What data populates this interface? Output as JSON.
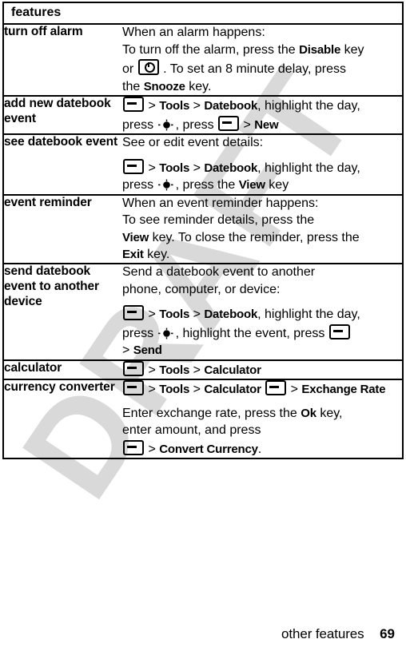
{
  "watermark": {
    "text": "DRAFT"
  },
  "table": {
    "header": {
      "label": "features"
    },
    "rows": [
      {
        "feature": "turn off alarm",
        "blocks": [
          {
            "lines": [
              {
                "parts": [
                  {
                    "t": "text",
                    "v": "When an alarm happens:"
                  }
                ]
              },
              {
                "parts": [
                  {
                    "t": "text",
                    "v": "To turn off the alarm, press the "
                  },
                  {
                    "t": "kw",
                    "v": "Disable"
                  },
                  {
                    "t": "text",
                    "v": " key"
                  }
                ]
              },
              {
                "parts": [
                  {
                    "t": "text",
                    "v": "or "
                  },
                  {
                    "t": "icon",
                    "v": "power-key-icon"
                  },
                  {
                    "t": "text",
                    "v": " . To set an 8 minute delay, press"
                  }
                ]
              },
              {
                "parts": [
                  {
                    "t": "text",
                    "v": "the "
                  },
                  {
                    "t": "kw",
                    "v": "Snooze"
                  },
                  {
                    "t": "text",
                    "v": " key."
                  }
                ]
              }
            ]
          }
        ]
      },
      {
        "feature": "add new datebook event",
        "blocks": [
          {
            "lines": [
              {
                "parts": [
                  {
                    "t": "icon",
                    "v": "menu-key-icon"
                  },
                  {
                    "t": "sep",
                    "v": " > "
                  },
                  {
                    "t": "kw",
                    "v": "Tools"
                  },
                  {
                    "t": "sep",
                    "v": " > "
                  },
                  {
                    "t": "kw",
                    "v": "Datebook"
                  },
                  {
                    "t": "text",
                    "v": ", highlight the day,"
                  }
                ]
              },
              {
                "parts": [
                  {
                    "t": "text",
                    "v": "press "
                  },
                  {
                    "t": "icon",
                    "v": "nav-key-icon"
                  },
                  {
                    "t": "text",
                    "v": ", press "
                  },
                  {
                    "t": "icon",
                    "v": "menu-key-icon"
                  },
                  {
                    "t": "sep",
                    "v": " > "
                  },
                  {
                    "t": "kw",
                    "v": "New"
                  }
                ]
              }
            ]
          }
        ]
      },
      {
        "feature": "see datebook event",
        "blocks": [
          {
            "lines": [
              {
                "parts": [
                  {
                    "t": "text",
                    "v": "See or edit event details:"
                  }
                ]
              }
            ]
          },
          {
            "gap": true,
            "lines": [
              {
                "parts": [
                  {
                    "t": "icon",
                    "v": "menu-key-icon"
                  },
                  {
                    "t": "sep",
                    "v": " > "
                  },
                  {
                    "t": "kw",
                    "v": "Tools"
                  },
                  {
                    "t": "sep",
                    "v": " > "
                  },
                  {
                    "t": "kw",
                    "v": "Datebook"
                  },
                  {
                    "t": "text",
                    "v": ", highlight the day,"
                  }
                ]
              },
              {
                "parts": [
                  {
                    "t": "text",
                    "v": "press "
                  },
                  {
                    "t": "icon",
                    "v": "nav-key-icon"
                  },
                  {
                    "t": "text",
                    "v": ", press the "
                  },
                  {
                    "t": "kw",
                    "v": "View"
                  },
                  {
                    "t": "text",
                    "v": " key"
                  }
                ]
              }
            ]
          }
        ]
      },
      {
        "feature": "event reminder",
        "blocks": [
          {
            "lines": [
              {
                "parts": [
                  {
                    "t": "text",
                    "v": "When an event reminder happens:"
                  }
                ]
              },
              {
                "parts": [
                  {
                    "t": "text",
                    "v": "To see reminder details, press the"
                  }
                ]
              },
              {
                "parts": [
                  {
                    "t": "kw",
                    "v": "View"
                  },
                  {
                    "t": "text",
                    "v": " key. To close the reminder, press the"
                  }
                ]
              },
              {
                "parts": [
                  {
                    "t": "kw",
                    "v": "Exit"
                  },
                  {
                    "t": "text",
                    "v": " key."
                  }
                ]
              }
            ]
          }
        ]
      },
      {
        "feature": "send datebook event to another device",
        "blocks": [
          {
            "lines": [
              {
                "parts": [
                  {
                    "t": "text",
                    "v": "Send a datebook event to another"
                  }
                ]
              },
              {
                "parts": [
                  {
                    "t": "text",
                    "v": "phone, computer, or device:"
                  }
                ]
              }
            ]
          },
          {
            "gap": true,
            "lines": [
              {
                "parts": [
                  {
                    "t": "icon",
                    "v": "menu-key-icon"
                  },
                  {
                    "t": "sep",
                    "v": " > "
                  },
                  {
                    "t": "kw",
                    "v": "Tools"
                  },
                  {
                    "t": "sep",
                    "v": " > "
                  },
                  {
                    "t": "kw",
                    "v": "Datebook"
                  },
                  {
                    "t": "text",
                    "v": ", highlight the day,"
                  }
                ]
              },
              {
                "parts": [
                  {
                    "t": "text",
                    "v": "press "
                  },
                  {
                    "t": "icon",
                    "v": "nav-key-icon"
                  },
                  {
                    "t": "text",
                    "v": ", highlight the event, press "
                  },
                  {
                    "t": "icon",
                    "v": "menu-key-icon"
                  }
                ]
              },
              {
                "parts": [
                  {
                    "t": "sep",
                    "v": "> "
                  },
                  {
                    "t": "kw",
                    "v": "Send"
                  }
                ]
              }
            ]
          }
        ]
      },
      {
        "feature": "calculator",
        "blocks": [
          {
            "lines": [
              {
                "parts": [
                  {
                    "t": "icon",
                    "v": "menu-key-icon"
                  },
                  {
                    "t": "sep",
                    "v": " > "
                  },
                  {
                    "t": "kw",
                    "v": "Tools"
                  },
                  {
                    "t": "sep",
                    "v": " > "
                  },
                  {
                    "t": "kw",
                    "v": "Calculator"
                  }
                ]
              }
            ]
          }
        ]
      },
      {
        "feature": "currency converter",
        "blocks": [
          {
            "lines": [
              {
                "parts": [
                  {
                    "t": "icon",
                    "v": "menu-key-icon"
                  },
                  {
                    "t": "sep",
                    "v": " > "
                  },
                  {
                    "t": "kw",
                    "v": "Tools"
                  },
                  {
                    "t": "sep",
                    "v": " > "
                  },
                  {
                    "t": "kw",
                    "v": "Calculator"
                  },
                  {
                    "t": "text",
                    "v": "  "
                  },
                  {
                    "t": "icon",
                    "v": "menu-key-icon"
                  },
                  {
                    "t": "sep",
                    "v": " > "
                  },
                  {
                    "t": "kw",
                    "v": "Exchange Rate"
                  }
                ]
              }
            ]
          },
          {
            "gap": true,
            "lines": [
              {
                "parts": [
                  {
                    "t": "text",
                    "v": "Enter exchange rate, press the "
                  },
                  {
                    "t": "kw",
                    "v": "Ok"
                  },
                  {
                    "t": "text",
                    "v": " key,"
                  }
                ]
              },
              {
                "parts": [
                  {
                    "t": "text",
                    "v": "enter amount, and press"
                  }
                ]
              },
              {
                "parts": [
                  {
                    "t": "icon",
                    "v": "menu-key-icon"
                  },
                  {
                    "t": "sep",
                    "v": " > "
                  },
                  {
                    "t": "kw",
                    "v": "Convert Currency"
                  },
                  {
                    "t": "text",
                    "v": "."
                  }
                ]
              }
            ]
          }
        ]
      }
    ]
  },
  "footer": {
    "section": "other features",
    "page_number": "69"
  }
}
